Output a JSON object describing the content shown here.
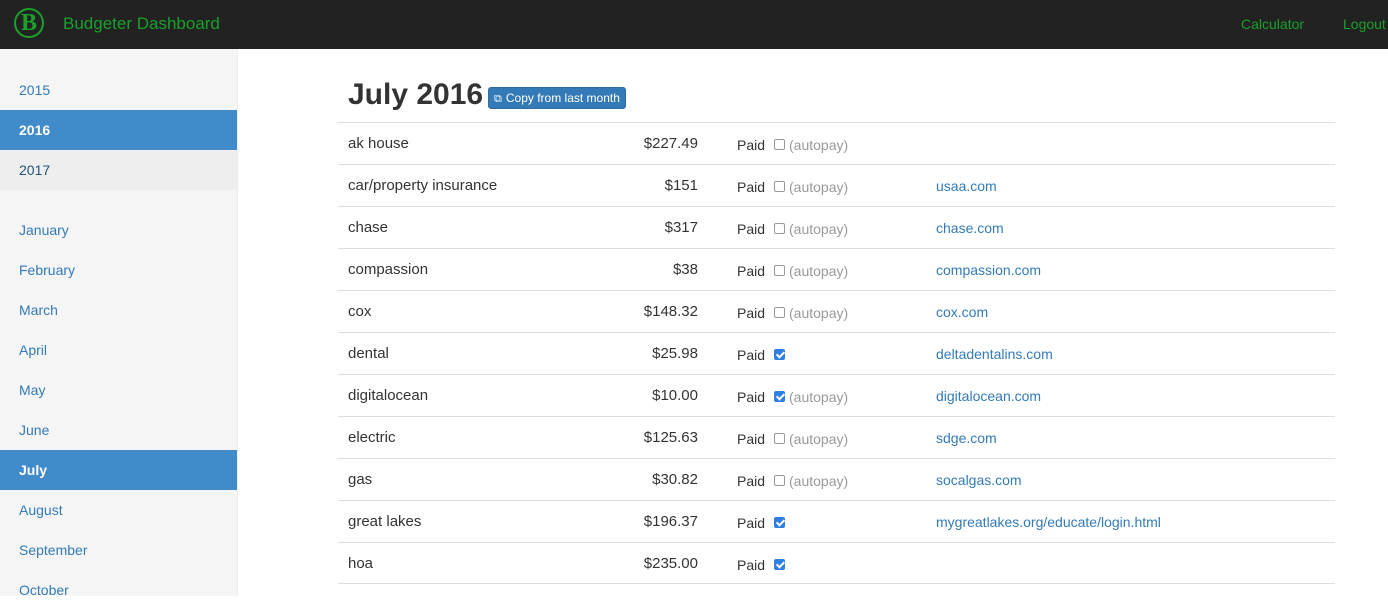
{
  "navbar": {
    "logo_letter": "B",
    "brand": "Budgeter Dashboard",
    "links": [
      "Calculator",
      "Logout"
    ],
    "accent_color": "#19a12b"
  },
  "sidebar": {
    "years": [
      {
        "label": "2015",
        "state": "normal"
      },
      {
        "label": "2016",
        "state": "active"
      },
      {
        "label": "2017",
        "state": "current"
      }
    ],
    "months": [
      {
        "label": "January",
        "state": "normal"
      },
      {
        "label": "February",
        "state": "normal"
      },
      {
        "label": "March",
        "state": "normal"
      },
      {
        "label": "April",
        "state": "normal"
      },
      {
        "label": "May",
        "state": "normal"
      },
      {
        "label": "June",
        "state": "normal"
      },
      {
        "label": "July",
        "state": "active"
      },
      {
        "label": "August",
        "state": "normal"
      },
      {
        "label": "September",
        "state": "normal"
      },
      {
        "label": "October",
        "state": "normal"
      }
    ],
    "active_color": "#428bca"
  },
  "main": {
    "title": "July 2016",
    "copy_button": {
      "label": "Copy from last month",
      "icon": "copy-icon"
    },
    "paid_label": "Paid",
    "autopay_label": "(autopay)",
    "bills": [
      {
        "name": "ak house",
        "amount": "$227.49",
        "paid": false,
        "autopay": true,
        "link": ""
      },
      {
        "name": "car/property insurance",
        "amount": "$151",
        "paid": false,
        "autopay": true,
        "link": "usaa.com"
      },
      {
        "name": "chase",
        "amount": "$317",
        "paid": false,
        "autopay": true,
        "link": "chase.com"
      },
      {
        "name": "compassion",
        "amount": "$38",
        "paid": false,
        "autopay": true,
        "link": "compassion.com"
      },
      {
        "name": "cox",
        "amount": "$148.32",
        "paid": false,
        "autopay": true,
        "link": "cox.com"
      },
      {
        "name": "dental",
        "amount": "$25.98",
        "paid": true,
        "autopay": false,
        "link": "deltadentalins.com"
      },
      {
        "name": "digitalocean",
        "amount": "$10.00",
        "paid": true,
        "autopay": true,
        "link": "digitalocean.com"
      },
      {
        "name": "electric",
        "amount": "$125.63",
        "paid": false,
        "autopay": true,
        "link": "sdge.com"
      },
      {
        "name": "gas",
        "amount": "$30.82",
        "paid": false,
        "autopay": true,
        "link": "socalgas.com"
      },
      {
        "name": "great lakes",
        "amount": "$196.37",
        "paid": true,
        "autopay": false,
        "link": "mygreatlakes.org/educate/login.html"
      },
      {
        "name": "hoa",
        "amount": "$235.00",
        "paid": true,
        "autopay": false,
        "link": ""
      }
    ]
  }
}
